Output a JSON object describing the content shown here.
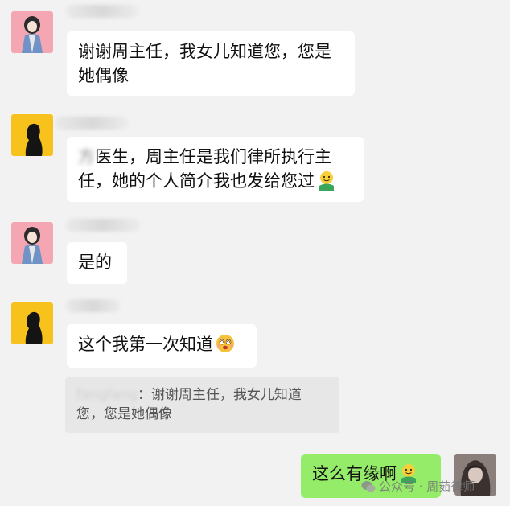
{
  "contacts": {
    "a": {
      "name": "fangfang"
    },
    "b": {
      "name": "王某某"
    }
  },
  "messages": [
    {
      "text": "谢谢周主任，我女儿知道您，您是",
      "text2": "她偶像"
    },
    {
      "prefix": "方",
      "line1": "医生，周主任是我们律所执行主",
      "line2": "任，她的个人简介我也发给您过",
      "emoji": "smile-hug-emoji"
    },
    {
      "text": "是的"
    },
    {
      "text": "这个我第一次知道",
      "emoji": "dizzy-emoji"
    },
    {
      "text": "这么有缘啊",
      "emoji": "smile-hug-emoji"
    }
  ],
  "quote": {
    "name": "fangfang",
    "sep": "：",
    "line1": "谢谢周主任，我女儿知道",
    "line2": "您，您是她偶像"
  },
  "watermark": {
    "label": "公众号 · 周茹律师"
  },
  "colors": {
    "background": "#f2f2f2",
    "bubble_incoming": "#ffffff",
    "bubble_outgoing": "#95ec69",
    "quote_bg": "#e7e7e7",
    "avatar_pink": "#f4a7b3",
    "avatar_yellow": "#f8c21c"
  }
}
